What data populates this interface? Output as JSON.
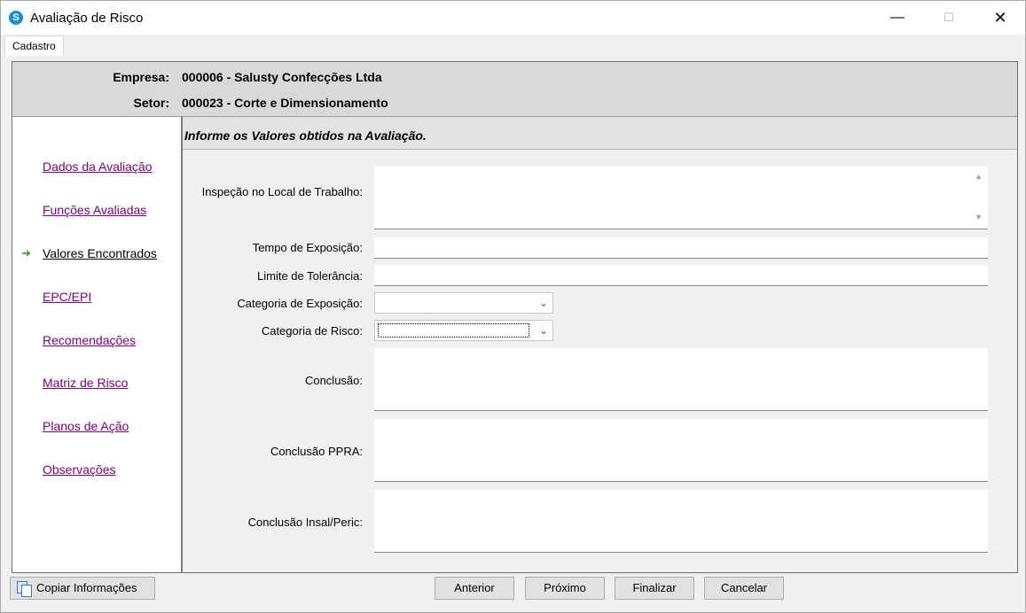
{
  "window": {
    "title": "Avaliação de Risco",
    "icon": "app-logo-icon"
  },
  "menu": {
    "tab": "Cadastro"
  },
  "header": {
    "empresa_label": "Empresa:",
    "empresa_value": "000006 - Salusty Confecções Ltda",
    "setor_label": "Setor:",
    "setor_value": "000023 - Corte e Dimensionamento"
  },
  "sidebar": {
    "items": [
      {
        "label": "Dados da Avaliação"
      },
      {
        "label": "Funções Avaliadas"
      },
      {
        "label": "Valores Encontrados",
        "active": true
      },
      {
        "label": "EPC/EPI"
      },
      {
        "label": "Recomendações"
      },
      {
        "label": "Matriz de Risco"
      },
      {
        "label": "Planos de Ação"
      },
      {
        "label": "Observações"
      }
    ]
  },
  "content": {
    "heading": "Informe os Valores obtidos na Avaliação.",
    "fields": {
      "inspecao_label": "Inspeção no Local de Trabalho:",
      "tempo_label": "Tempo de Exposição:",
      "limite_label": "Limite de Tolerância:",
      "cat_exposicao_label": "Categoria de Exposição:",
      "cat_risco_label": "Categoria de Risco:",
      "conclusao_label": "Conclusão:",
      "conclusao_ppra_label": "Conclusão PPRA:",
      "conclusao_insal_label": "Conclusão Insal/Peric:"
    }
  },
  "buttons": {
    "copy": "Copiar Informações",
    "anterior": "Anterior",
    "proximo": "Próximo",
    "finalizar": "Finalizar",
    "cancelar": "Cancelar"
  },
  "colors": {
    "link": "#800080",
    "active_arrow": "#3a9a3a",
    "header_bg": "#d9d9d9"
  }
}
